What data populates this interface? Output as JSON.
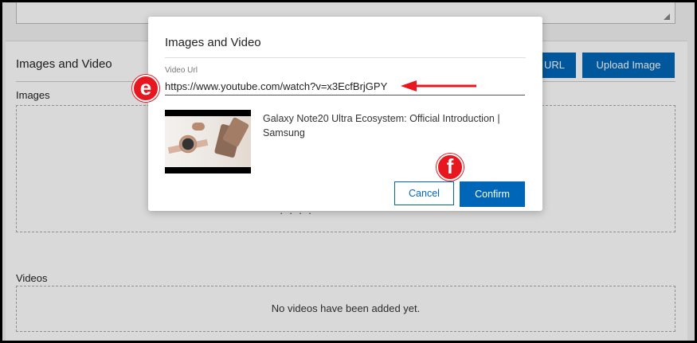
{
  "background": {
    "section_title": "Images and Video",
    "url_button_label": "URL",
    "upload_button_label": "Upload Image",
    "images_label": "Images",
    "images_hint": "· · · ·",
    "videos_label": "Videos",
    "videos_empty": "No videos have been added yet."
  },
  "modal": {
    "title": "Images and Video",
    "video_url_label": "Video Url",
    "video_url_value": "https://www.youtube.com/watch?v=x3EcfBrjGPY",
    "video_title": "Galaxy Note20 Ultra Ecosystem: Official Introduction | Samsung",
    "cancel_label": "Cancel",
    "confirm_label": "Confirm"
  },
  "annotations": {
    "step_e": "e",
    "step_f": "f",
    "color": "#e8161e"
  },
  "colors": {
    "primary": "#0067b8"
  }
}
